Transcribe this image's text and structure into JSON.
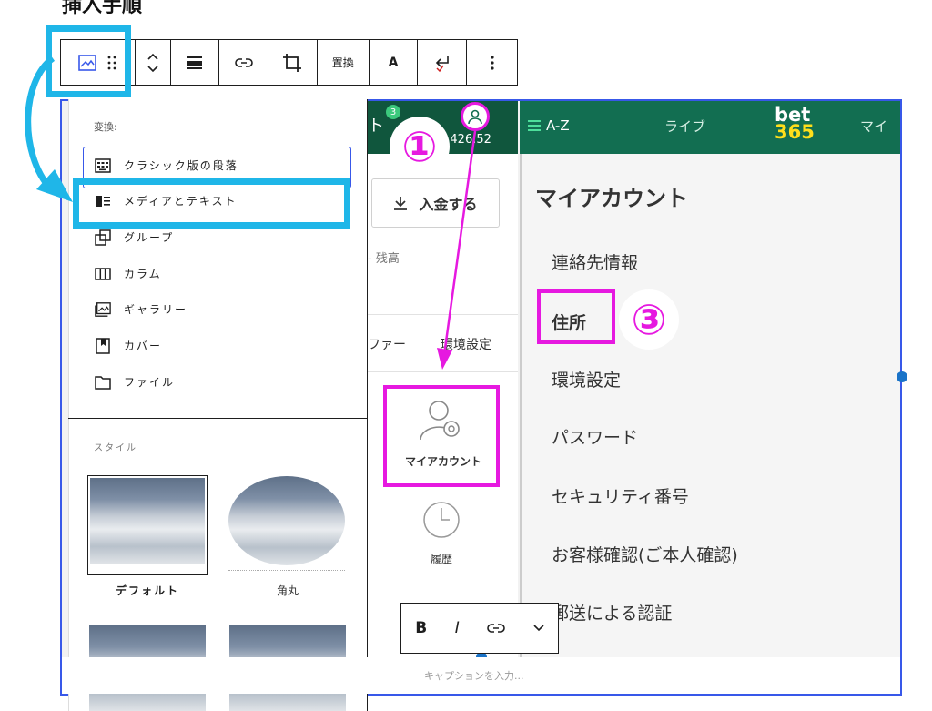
{
  "page_title": "挿入手順",
  "toolbar": {
    "replace_label": "置換",
    "text_color_label": "A"
  },
  "dropdown": {
    "transform_label": "変換:",
    "items": [
      {
        "label": "クラシック版の段落",
        "icon": "classic-icon"
      },
      {
        "label": "メディアとテキスト",
        "icon": "media-text-icon"
      },
      {
        "label": "グループ",
        "icon": "group-icon"
      },
      {
        "label": "カラム",
        "icon": "columns-icon"
      },
      {
        "label": "ギャラリー",
        "icon": "gallery-icon"
      },
      {
        "label": "カバー",
        "icon": "cover-icon"
      },
      {
        "label": "ファイル",
        "icon": "file-icon"
      }
    ],
    "styles_label": "スタイル",
    "styles": [
      {
        "label": "デフォルト"
      },
      {
        "label": "角丸"
      }
    ]
  },
  "app_middle": {
    "badge_count": "3",
    "balance": "4,426.52",
    "deposit_label": "入金する",
    "balance_label": "残高",
    "offers_label": "ファー",
    "settings_tab_label": "環境設定",
    "my_account_label": "マイアカウント",
    "history_label": "履歴"
  },
  "app_right": {
    "az_label": "A-Z",
    "live_label": "ライブ",
    "logo_top": "bet",
    "logo_bottom": "365",
    "my_account_short": "マイ",
    "heading": "マイアカウント",
    "menu": [
      "連絡先情報",
      "住所",
      "環境設定",
      "パスワード",
      "セキュリティ番号",
      "お客様確認(ご本人確認)",
      "郵送による認証"
    ]
  },
  "annotations": {
    "step1": "①",
    "step3": "③"
  },
  "format_bar": {
    "bold": "B",
    "italic": "I"
  },
  "caption_placeholder": "キャプションを入力...",
  "colors": {
    "highlight_cyan": "#1fb6e8",
    "highlight_magenta": "#e619e0",
    "bet365_green": "#126e51",
    "bet365_yellow": "#ffdf1b",
    "wp_blue": "#3858e9"
  }
}
